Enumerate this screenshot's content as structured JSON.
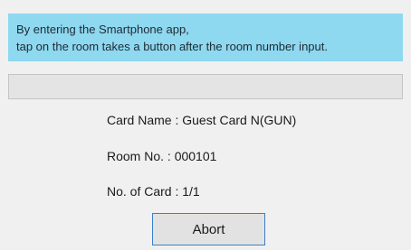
{
  "banner": {
    "line1": "By entering the Smartphone app,",
    "line2": "tap on the room takes a button after the room number input."
  },
  "progress": {
    "fraction": 0
  },
  "info": {
    "card_name": "Card Name : Guest Card N(GUN)",
    "room_no": "Room No. : 000101",
    "no_of_card": "No. of Card : 1/1"
  },
  "actions": {
    "abort_label": "Abort"
  },
  "colors": {
    "banner_bg": "#8ed8f0",
    "button_border": "#3d7fc4",
    "panel_bg": "#f0f0f0"
  }
}
